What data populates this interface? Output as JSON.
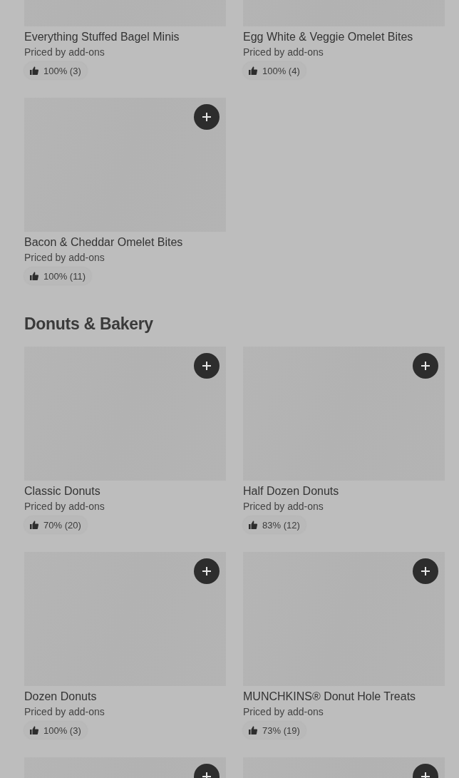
{
  "sections": [
    {
      "items": [
        {
          "kind": "full_cut",
          "name": "Everything Stuffed Bagel Minis",
          "price": "Priced by add-ons",
          "rating": "100% (3)"
        },
        {
          "kind": "full_cut",
          "name": "Egg White & Veggie Omelet Bites",
          "price": "Priced by add-ons",
          "rating": "100% (4)"
        },
        {
          "kind": "full",
          "name": "Bacon & Cheddar Omelet Bites",
          "price": "Priced by add-ons",
          "rating": "100% (11)"
        }
      ]
    },
    {
      "title": "Donuts & Bakery",
      "items": [
        {
          "kind": "full",
          "name": "Classic Donuts",
          "price": "Priced by add-ons",
          "rating": "70% (20)"
        },
        {
          "kind": "full",
          "name": "Half Dozen Donuts",
          "price": "Priced by add-ons",
          "rating": "83% (12)"
        },
        {
          "kind": "full",
          "name": "Dozen Donuts",
          "price": "Priced by add-ons",
          "rating": "100% (3)"
        },
        {
          "kind": "full",
          "name": "MUNCHKINS® Donut Hole Treats",
          "price": "Priced by add-ons",
          "rating": "73% (19)"
        },
        {
          "kind": "image_only"
        },
        {
          "kind": "image_only"
        }
      ]
    }
  ]
}
